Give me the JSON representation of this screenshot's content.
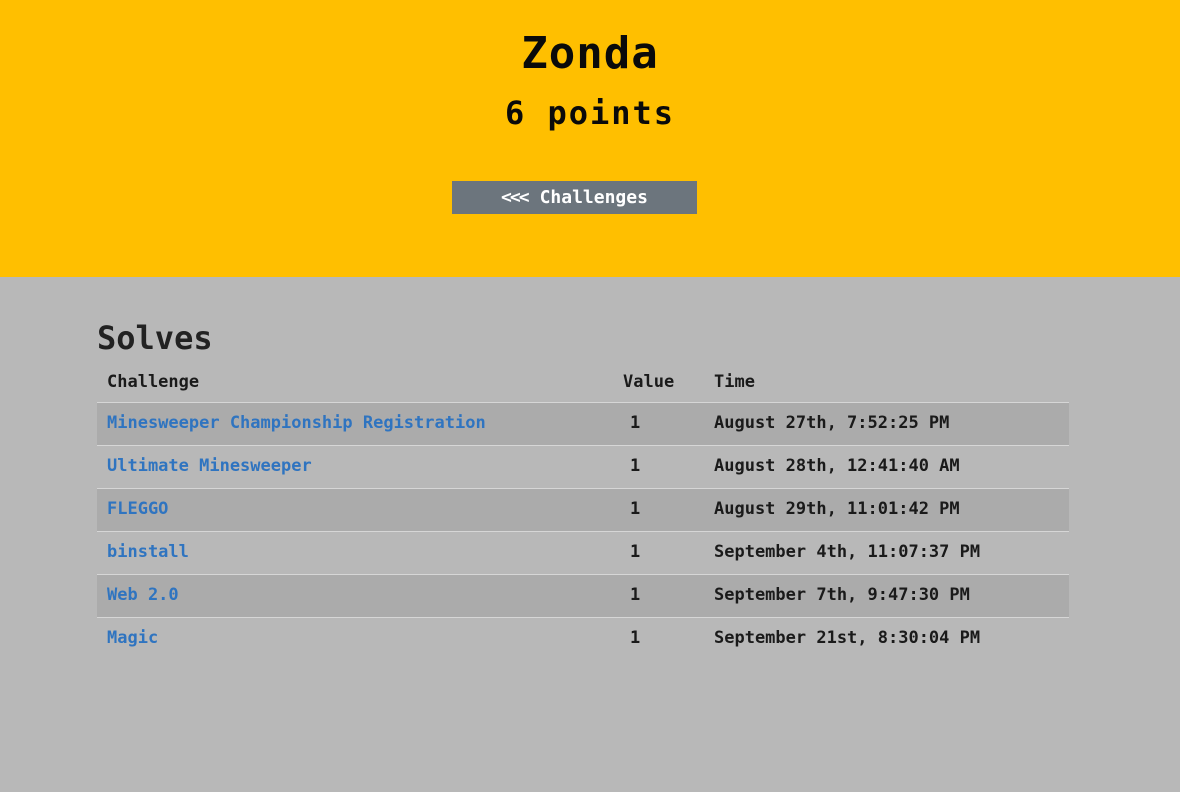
{
  "team": {
    "name": "Zonda",
    "points": "6 points",
    "back_button": "Challenges",
    "back_chevrons": "<<<"
  },
  "solves": {
    "title": "Solves",
    "columns": {
      "challenge": "Challenge",
      "value": "Value",
      "time": "Time"
    },
    "rows": [
      {
        "challenge": "Minesweeper Championship Registration",
        "value": "1",
        "time": "August 27th, 7:52:25 PM"
      },
      {
        "challenge": "Ultimate Minesweeper",
        "value": "1",
        "time": "August 28th, 12:41:40 AM"
      },
      {
        "challenge": "FLEGGO",
        "value": "1",
        "time": "August 29th, 11:01:42 PM"
      },
      {
        "challenge": "binstall",
        "value": "1",
        "time": "September 4th, 11:07:37 PM"
      },
      {
        "challenge": "Web 2.0",
        "value": "1",
        "time": "September 7th, 9:47:30 PM"
      },
      {
        "challenge": "Magic",
        "value": "1",
        "time": "September 21st, 8:30:04 PM"
      }
    ]
  },
  "colors": {
    "header_bg": "#ffbf00",
    "page_bg": "#b8b8b8",
    "button_bg": "#6c757d",
    "link": "#2f74c0"
  }
}
